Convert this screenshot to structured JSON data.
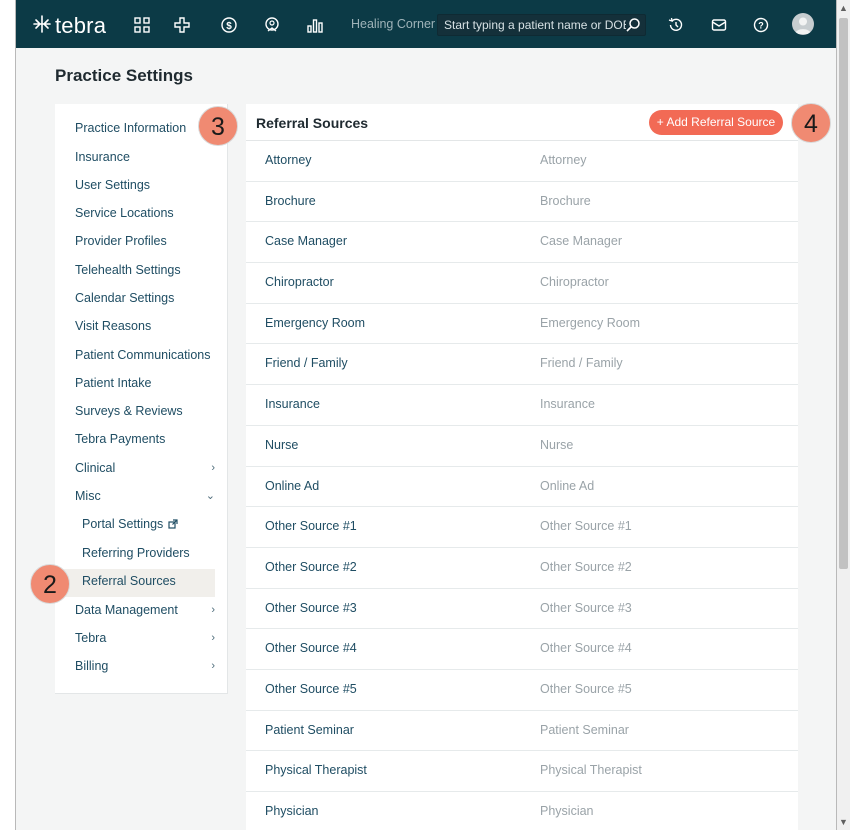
{
  "topbar": {
    "brand": "tebra",
    "practice_name": "Healing Corner",
    "search_placeholder": "Start typing a patient name or DOB",
    "nav_icons": [
      "dashboard-icon",
      "medical-cross-icon",
      "dollar-icon",
      "shield-icon",
      "bar-chart-icon"
    ],
    "right_icons": [
      "history-icon",
      "mail-icon",
      "help-icon"
    ]
  },
  "page": {
    "title": "Practice Settings"
  },
  "sidebar": {
    "items": [
      {
        "label": "Practice Information",
        "chevron": ""
      },
      {
        "label": "Insurance",
        "chevron": ""
      },
      {
        "label": "User Settings",
        "chevron": ""
      },
      {
        "label": "Service Locations",
        "chevron": ""
      },
      {
        "label": "Provider Profiles",
        "chevron": ""
      },
      {
        "label": "Telehealth Settings",
        "chevron": ""
      },
      {
        "label": "Calendar Settings",
        "chevron": ""
      },
      {
        "label": "Visit Reasons",
        "chevron": ""
      },
      {
        "label": "Patient Communications",
        "chevron": ""
      },
      {
        "label": "Patient Intake",
        "chevron": ""
      },
      {
        "label": "Surveys & Reviews",
        "chevron": ""
      },
      {
        "label": "Tebra Payments",
        "chevron": ""
      },
      {
        "label": "Clinical",
        "chevron": "›"
      },
      {
        "label": "Misc",
        "chevron": "⌄"
      },
      {
        "label": "Portal Settings",
        "chevron": ""
      },
      {
        "label": "Referring Providers",
        "chevron": ""
      },
      {
        "label": "Referral Sources",
        "chevron": ""
      },
      {
        "label": "Data Management",
        "chevron": "›"
      },
      {
        "label": "Tebra",
        "chevron": "›"
      },
      {
        "label": "Billing",
        "chevron": "›"
      }
    ]
  },
  "content": {
    "title": "Referral Sources",
    "add_button": "+ Add Referral Source",
    "rows": [
      {
        "name": "Attorney",
        "description": "Attorney"
      },
      {
        "name": "Brochure",
        "description": "Brochure"
      },
      {
        "name": "Case Manager",
        "description": "Case Manager"
      },
      {
        "name": "Chiropractor",
        "description": "Chiropractor"
      },
      {
        "name": "Emergency Room",
        "description": "Emergency Room"
      },
      {
        "name": "Friend / Family",
        "description": "Friend / Family"
      },
      {
        "name": "Insurance",
        "description": "Insurance"
      },
      {
        "name": "Nurse",
        "description": "Nurse"
      },
      {
        "name": "Online Ad",
        "description": "Online Ad"
      },
      {
        "name": "Other Source #1",
        "description": "Other Source #1"
      },
      {
        "name": "Other Source #2",
        "description": "Other Source #2"
      },
      {
        "name": "Other Source #3",
        "description": "Other Source #3"
      },
      {
        "name": "Other Source #4",
        "description": "Other Source #4"
      },
      {
        "name": "Other Source #5",
        "description": "Other Source #5"
      },
      {
        "name": "Patient Seminar",
        "description": "Patient Seminar"
      },
      {
        "name": "Physical Therapist",
        "description": "Physical Therapist"
      },
      {
        "name": "Physician",
        "description": "Physician"
      }
    ]
  },
  "callouts": {
    "two": "2",
    "three": "3",
    "four": "4"
  },
  "colors": {
    "topbar": "#0c3a46",
    "accent": "#f26a55",
    "callout": "#f08a72",
    "link": "#1f4d63",
    "muted": "#9aa3a8"
  }
}
